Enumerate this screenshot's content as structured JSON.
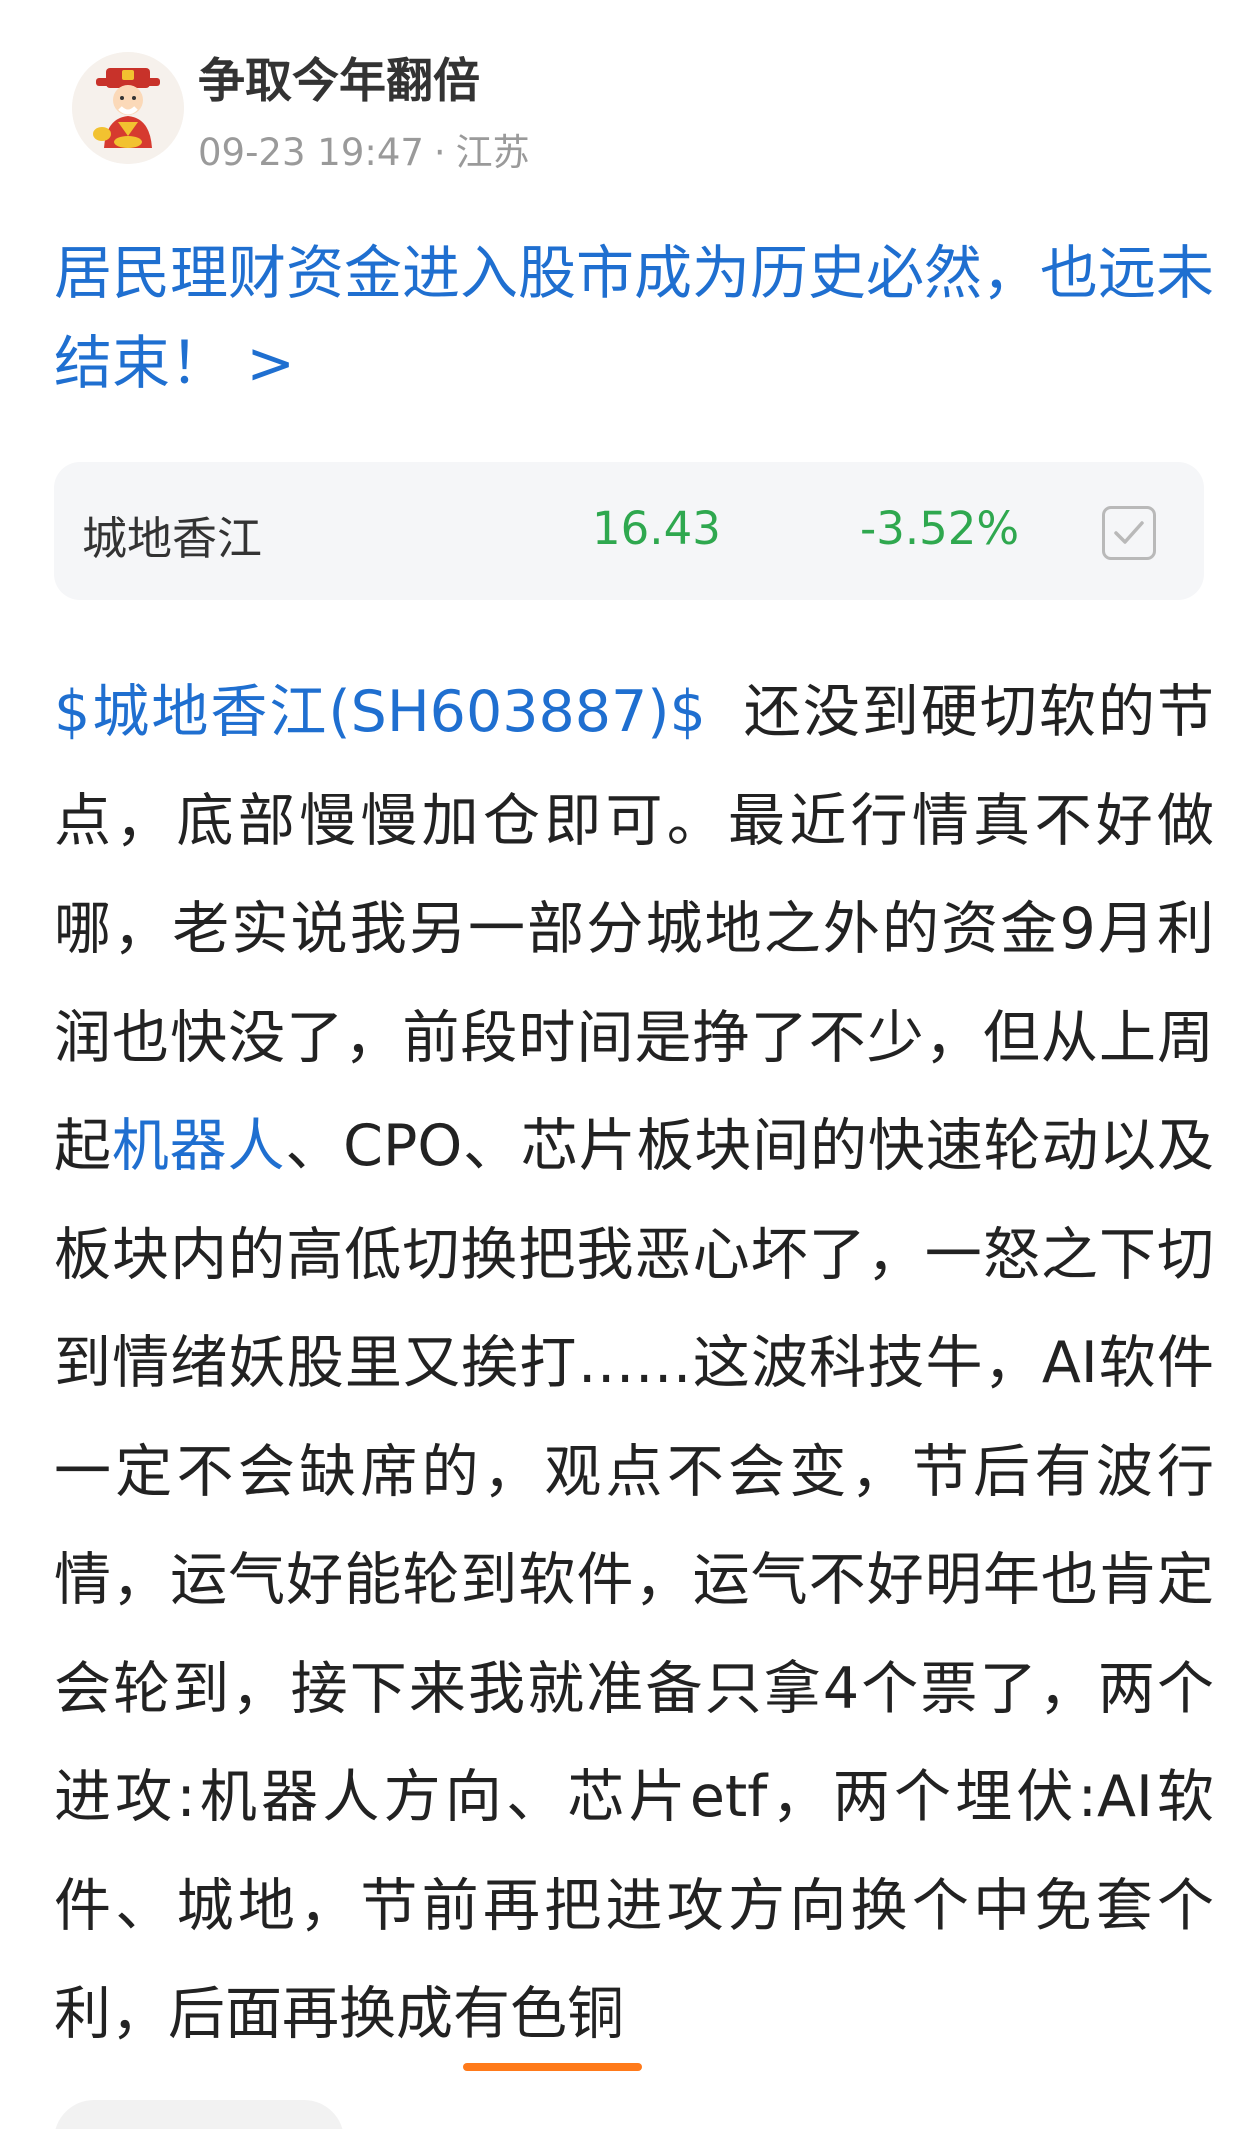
{
  "header": {
    "author_name": "争取今年翻倍",
    "timestamp": "09-23 19:47",
    "separator": "·",
    "location": "江苏"
  },
  "post": {
    "title": "居民理财资金进入股市成为历史必然，也远未结束！ >",
    "body": {
      "stock_tag": "$城地香江(SH603887)$",
      "text_1": "还没到硬切软的节点，底部慢慢加仓即可。最近行情真不好做哪，老实说我另一部分城地之外的资金9月利润也快没了，前段时间是挣了不少，但从上周起",
      "topic_link": "机器人",
      "text_2": "、CPO、芯片板块间的快速轮动以及板块内的高低切换把我恶心坏了，一怒之下切到情绪妖股里又挨打……这波科技牛，AI软件一定不会缺席的，观点不会变，节后有波行情，运气好能轮到软件，运气不好明年也肯定会轮到，接下来我就准备只拿4个票了，两个进攻:机器人方向、芯片etf，两个埋伏:AI软件、城地，节前再把进攻方向换个中免套个利，后面再换成",
      "underlined_text": "有色铜"
    }
  },
  "stock_card": {
    "name": "城地香江",
    "price": "16.43",
    "change": "-3.52%",
    "checkbox_icon": "checkbox-checked-icon"
  },
  "colors": {
    "link_blue": "#1f6fd0",
    "stock_green": "#2fa84f",
    "highlight_orange": "#ff7a1a",
    "card_bg": "#f5f6f8"
  }
}
